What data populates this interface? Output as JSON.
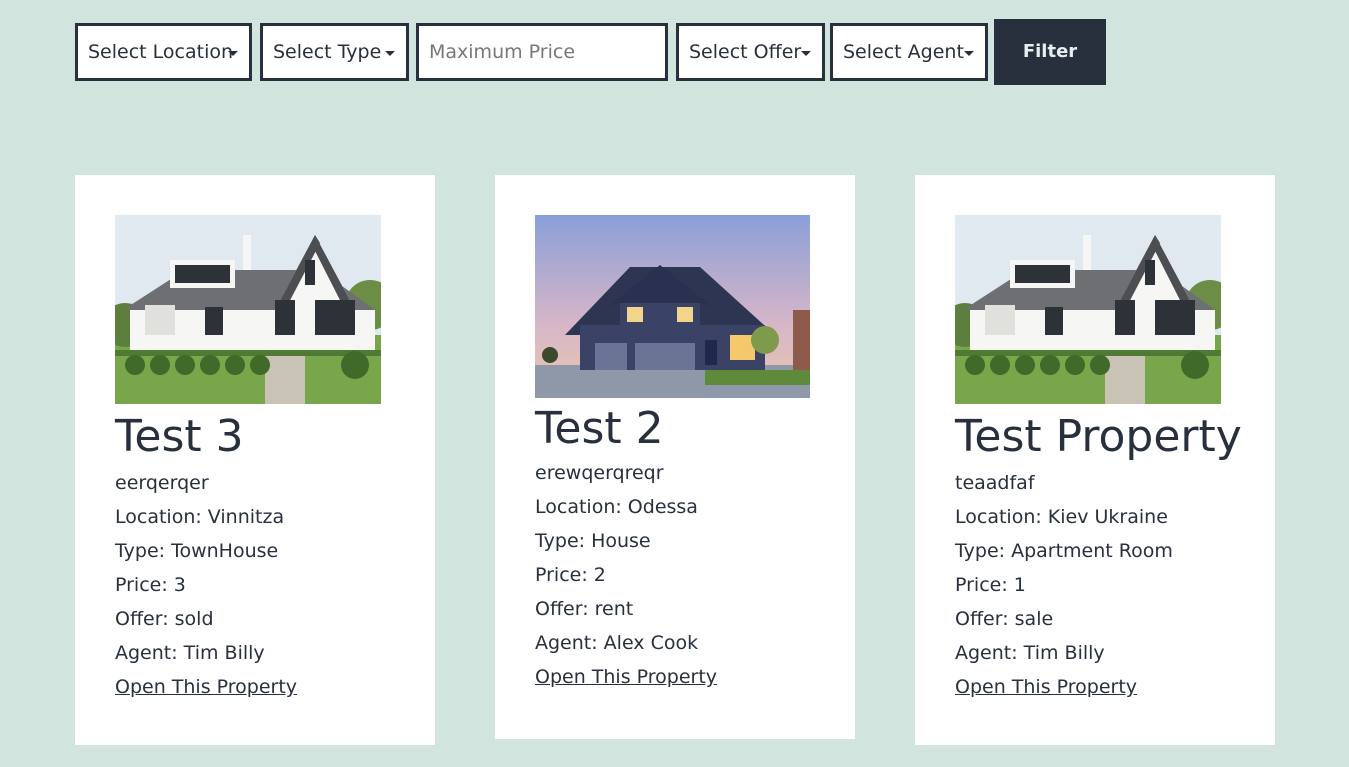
{
  "filters": {
    "location": "Select Location",
    "type": "Select Type",
    "max_price_placeholder": "Maximum Price",
    "offer": "Select Offer",
    "agent": "Select Agent",
    "button": "Filter"
  },
  "properties": [
    {
      "title": "Test 3",
      "description": "eerqerqer",
      "location": "Location: Vinnitza",
      "type": "Type: TownHouse",
      "price": "Price: 3",
      "offer": "Offer: sold",
      "agent": "Agent: Tim Billy",
      "link": "Open This Property"
    },
    {
      "title": "Test 2",
      "description": "erewqerqreqr",
      "location": "Location: Odessa",
      "type": "Type: House",
      "price": "Price: 2",
      "offer": "Offer: rent",
      "agent": "Agent: Alex Cook",
      "link": "Open This Property"
    },
    {
      "title": "Test Property",
      "description": "teaadfaf",
      "location": "Location: Kiev Ukraine",
      "type": "Type: Apartment Room",
      "price": "Price: 1",
      "offer": "Offer: sale",
      "agent": "Agent: Tim Billy",
      "link": "Open This Property"
    }
  ],
  "colors": {
    "page_bg": "#d1e4de",
    "dark": "#28303d",
    "card_bg": "#ffffff"
  }
}
